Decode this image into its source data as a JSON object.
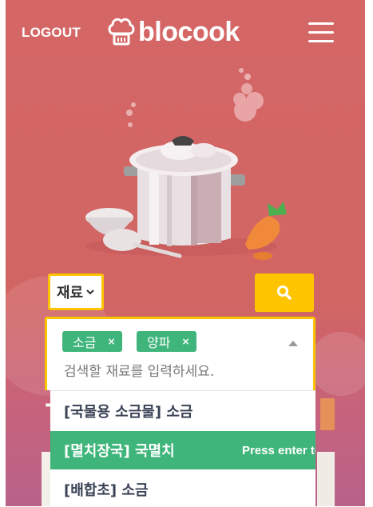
{
  "header": {
    "logout_label": "LOGOUT",
    "logo_text": "blocook",
    "logo_icon": "chef-hat-icon",
    "menu_icon": "hamburger-menu-icon"
  },
  "search": {
    "select_label": "재료",
    "placeholder": "검색할 재료를 입력하세요.",
    "button_icon": "search-icon",
    "tags": [
      {
        "label": "소금",
        "remove": "×"
      },
      {
        "label": "양파",
        "remove": "×"
      }
    ]
  },
  "dropdown": {
    "options": [
      {
        "label": "[국물용 소금물] 소금",
        "active": false
      },
      {
        "label": "[멸치장국] 국멸치",
        "active": true,
        "hint": "Press enter to select"
      },
      {
        "label": "[배합초] 소금",
        "active": false
      }
    ]
  },
  "colors": {
    "background": "#d46766",
    "accent_yellow": "#ffc400",
    "tag_green": "#3fb57b",
    "option_text": "#3a4256"
  }
}
